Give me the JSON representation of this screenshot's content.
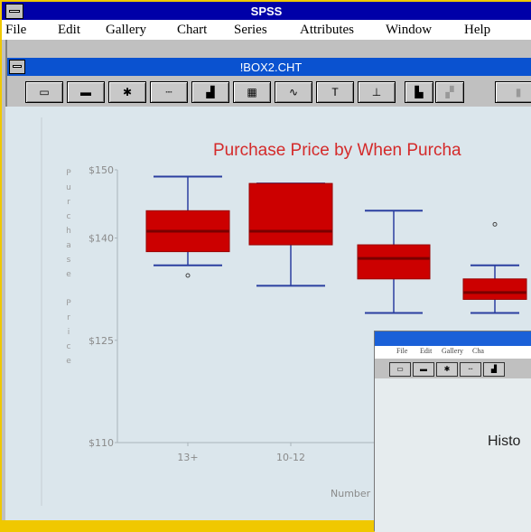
{
  "app": {
    "title": "SPSS"
  },
  "menu": [
    "File",
    "Edit",
    "Gallery",
    "Chart",
    "Series",
    "Attributes",
    "Window",
    "Help"
  ],
  "child_window": {
    "title": "!BOX2.CHT"
  },
  "toolbar_icons": [
    "frame-icon",
    "legend-icon",
    "marker-icon",
    "dotline-icon",
    "bar-icon",
    "table-icon",
    "line-icon",
    "text-icon",
    "axis-icon",
    "swap-icon",
    "edit-icon",
    "sort-icon"
  ],
  "toolbar_glyphs": [
    "▭",
    "▬",
    "✱",
    "┄",
    "▟",
    "▦",
    "∿",
    "T",
    "⊥",
    "▙",
    "▞",
    "▮"
  ],
  "chart": {
    "title": "Purchase Price by When Purcha",
    "y_axis_letters": [
      "P",
      "u",
      "r",
      "c",
      "h",
      "a",
      "s",
      "e",
      "",
      "P",
      "r",
      "i",
      "c",
      "e"
    ],
    "xlabel": "Number"
  },
  "chart_data": {
    "type": "box",
    "title": "Purchase Price by When Purcha",
    "ylabel": "Purchase Price",
    "xlabel": "Number",
    "ylim": [
      110,
      150
    ],
    "yticks": [
      "$110",
      "$125",
      "$140",
      "$150"
    ],
    "categories": [
      "13+",
      "10-12",
      "",
      ""
    ],
    "boxes": [
      {
        "min": 136,
        "q1": 138,
        "median": 141,
        "q3": 144,
        "max": 149,
        "outlier": 134.5
      },
      {
        "min": 133,
        "q1": 139,
        "median": 141,
        "q3": 148,
        "max": 148
      },
      {
        "min": 129,
        "q1": 134,
        "median": 137,
        "q3": 139,
        "max": 144
      },
      {
        "min": 129,
        "q1": 131,
        "median": 132,
        "q3": 134,
        "max": 136,
        "outlier": 142
      }
    ],
    "color": "#cc0000"
  },
  "sub_window": {
    "menu": [
      "File",
      "Edit",
      "Gallery",
      "Cha"
    ],
    "title_fragment": "Histo"
  }
}
